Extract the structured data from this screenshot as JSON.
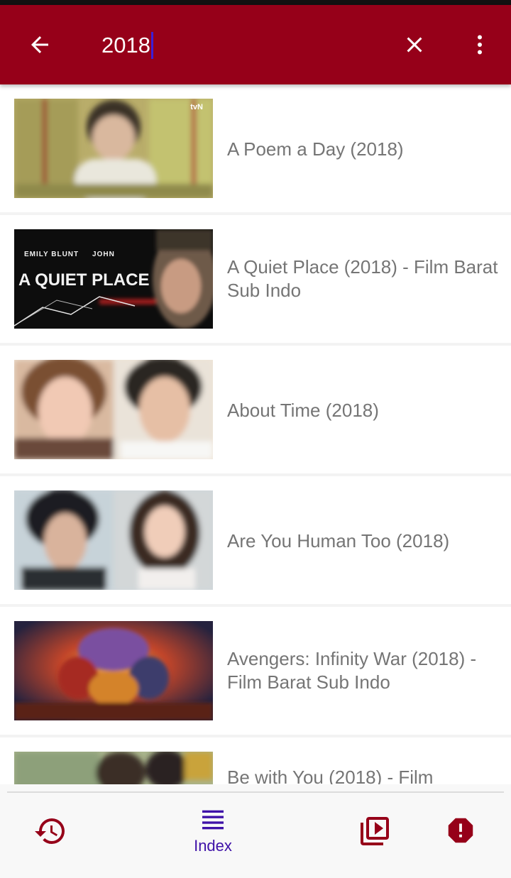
{
  "search": {
    "query": "2018"
  },
  "results": [
    {
      "title": "A Poem a Day (2018)",
      "thumb": "A Poem a Day poster"
    },
    {
      "title": "A Quiet Place (2018) - Film Barat Sub Indo",
      "thumb": "A Quiet Place poster",
      "poster_text": {
        "cast": "EMILY BLUNT     JOHN",
        "logo": "A QUIET PLACE"
      }
    },
    {
      "title": "About Time (2018)",
      "thumb": "About Time poster"
    },
    {
      "title": "Are You Human Too (2018)",
      "thumb": "Are You Human Too poster"
    },
    {
      "title": "Avengers: Infinity War (2018) - Film Barat Sub Indo",
      "thumb": "Avengers Infinity War poster"
    },
    {
      "title": "Be with You (2018) - Film",
      "thumb": "Be with You poster"
    }
  ],
  "poster_badges": {
    "tvn": "tvN"
  },
  "bottom_nav": {
    "index_label": "Index"
  },
  "colors": {
    "appbar": "#960019",
    "accent": "#3f12a8",
    "icon_red": "#960019"
  },
  "icons": {
    "back": "arrow-left-icon",
    "clear": "close-icon",
    "more": "more-vert-icon",
    "history": "history-icon",
    "index": "list-icon",
    "video": "video-library-icon",
    "report": "error-icon"
  }
}
